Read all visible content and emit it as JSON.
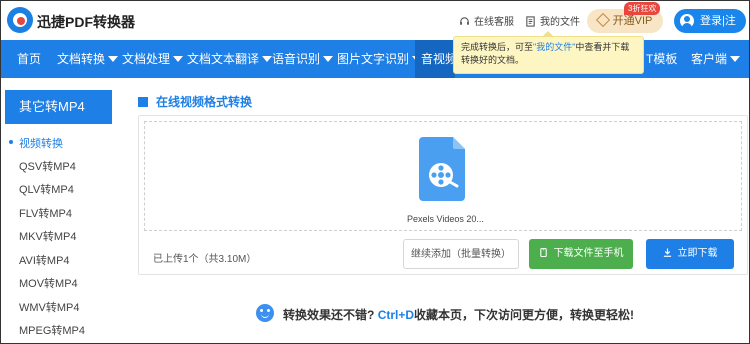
{
  "header": {
    "brand": "迅捷PDF转换器",
    "service_label": "在线客服",
    "files_label": "我的文件",
    "vip_label": "开通VIP",
    "vip_badge": "3折狂欢",
    "login_label": "登录|注册"
  },
  "nav": {
    "items": [
      {
        "label": "首页"
      },
      {
        "label": "文档转换"
      },
      {
        "label": "文档处理"
      },
      {
        "label": "文档文本翻译"
      },
      {
        "label": "语音识别"
      },
      {
        "label": "图片文字识别"
      },
      {
        "label": "音视频"
      },
      {
        "label": "T模板"
      },
      {
        "label": "客户端"
      }
    ]
  },
  "tooltip": {
    "text_before": "完成转换后，可至",
    "link": "\"我的文件\"",
    "text_after": "中查看并下载转换好的文档。"
  },
  "sidebar": {
    "title": "其它转MP4",
    "items": [
      {
        "label": "视频转换"
      },
      {
        "label": "QSV转MP4"
      },
      {
        "label": "QLV转MP4"
      },
      {
        "label": "FLV转MP4"
      },
      {
        "label": "MKV转MP4"
      },
      {
        "label": "AVI转MP4"
      },
      {
        "label": "MOV转MP4"
      },
      {
        "label": "WMV转MP4"
      },
      {
        "label": "MPEG转MP4"
      }
    ]
  },
  "main": {
    "title": "在线视频格式转换",
    "file_name": "Pexels Videos 20...",
    "upload_count": "已上传1个（共3.10M）",
    "add_button": "继续添加（批量转换）",
    "phone_button": "下载文件至手机",
    "download_button": "立即下载"
  },
  "footer": {
    "tip_before": "转换效果还不错?",
    "shortcut": "Ctrl+D",
    "tip_after": "收藏本页，下次访问更方便，转换更轻松!"
  },
  "colors": {
    "primary": "#1e7fe6",
    "nav_active": "#1566c0",
    "green": "#4cae4c",
    "tooltip_bg": "#fdf6c3"
  }
}
